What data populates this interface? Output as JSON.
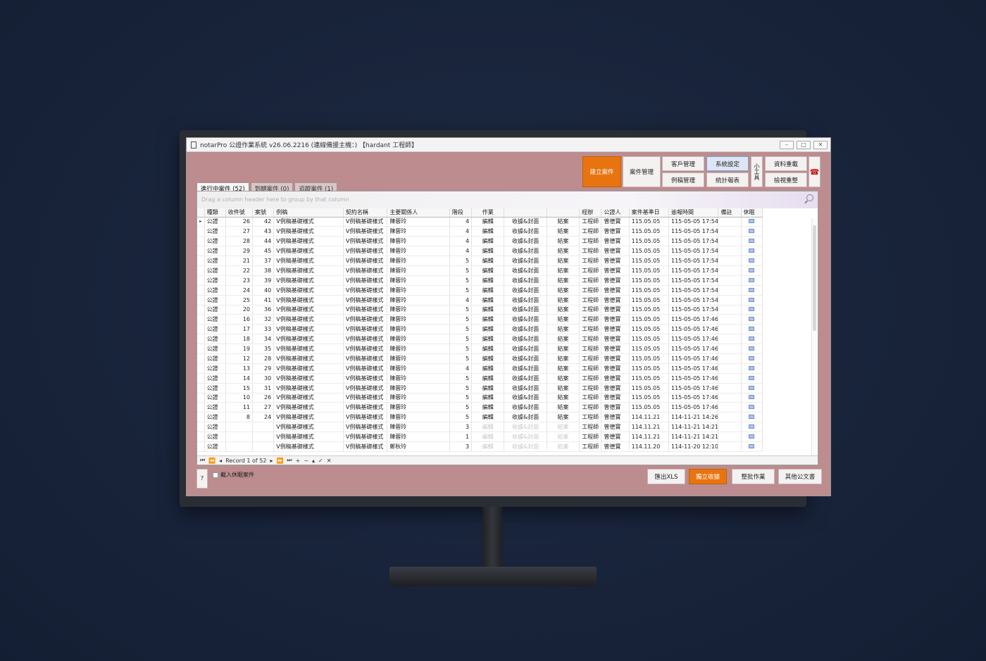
{
  "window": {
    "title": "notarPro 公證作業系統 v26.06.2216 (連線備援主機：) 【hardant 工程師】",
    "min_label": "–",
    "max_label": "□",
    "close_label": "✕"
  },
  "toolbar": {
    "create_case": "建立案件",
    "case_mgmt": "案件管理",
    "client_mgmt": "客戶管理",
    "system_settings": "系統設定",
    "template_mgmt": "例稿管理",
    "statistics": "統計報表",
    "tools": "小工具",
    "reload_data": "資料重載",
    "reset_view": "檢視重整",
    "phone_icon": "☎"
  },
  "tabs": [
    {
      "label": "進行中案件 (52)"
    },
    {
      "label": "到期案件 (0)"
    },
    {
      "label": "追蹤案件 (1)"
    }
  ],
  "grid": {
    "group_hint": "Drag a column header here to group by that column",
    "columns": [
      "種類",
      "收件號",
      "案號",
      "例稿",
      "契約名稱",
      "主要關係人",
      "階段",
      "作業",
      "",
      "",
      "經辦",
      "公證人",
      "案件基準日",
      "逾報時間",
      "備註",
      "休眠"
    ],
    "rows": [
      [
        "公證",
        "26",
        "42",
        "V例稿基礎樣式",
        "V例稿基礎樣式",
        "陳蓉玲",
        "4",
        "編輯",
        "收據&封面",
        "結案",
        "工程師",
        "曾德寶",
        "115.05.05",
        "115-05-05 17:54",
        ""
      ],
      [
        "公證",
        "27",
        "43",
        "V例稿基礎樣式",
        "V例稿基礎樣式",
        "陳蓉玲",
        "4",
        "編輯",
        "收據&封面",
        "結案",
        "工程師",
        "曾德寶",
        "115.05.05",
        "115-05-05 17:54",
        ""
      ],
      [
        "公證",
        "28",
        "44",
        "V例稿基礎樣式",
        "V例稿基礎樣式",
        "陳蓉玲",
        "4",
        "編輯",
        "收據&封面",
        "結案",
        "工程師",
        "曾德寶",
        "115.05.05",
        "115-05-05 17:54",
        ""
      ],
      [
        "公證",
        "29",
        "45",
        "V例稿基礎樣式",
        "V例稿基礎樣式",
        "陳蓉玲",
        "4",
        "編輯",
        "收據&封面",
        "結案",
        "工程師",
        "曾德寶",
        "115.05.05",
        "115-05-05 17:54",
        ""
      ],
      [
        "公證",
        "21",
        "37",
        "V例稿基礎樣式",
        "V例稿基礎樣式",
        "陳蓉玲",
        "5",
        "編輯",
        "收據&封面",
        "結案",
        "工程師",
        "曾德寶",
        "115.05.05",
        "115-05-05 17:54",
        ""
      ],
      [
        "公證",
        "22",
        "38",
        "V例稿基礎樣式",
        "V例稿基礎樣式",
        "陳蓉玲",
        "5",
        "編輯",
        "收據&封面",
        "結案",
        "工程師",
        "曾德寶",
        "115.05.05",
        "115-05-05 17:54",
        ""
      ],
      [
        "公證",
        "23",
        "39",
        "V例稿基礎樣式",
        "V例稿基礎樣式",
        "陳蓉玲",
        "5",
        "編輯",
        "收據&封面",
        "結案",
        "工程師",
        "曾德寶",
        "115.05.05",
        "115-05-05 17:54",
        ""
      ],
      [
        "公證",
        "24",
        "40",
        "V例稿基礎樣式",
        "V例稿基礎樣式",
        "陳蓉玲",
        "5",
        "編輯",
        "收據&封面",
        "結案",
        "工程師",
        "曾德寶",
        "115.05.05",
        "115-05-05 17:54",
        ""
      ],
      [
        "公證",
        "25",
        "41",
        "V例稿基礎樣式",
        "V例稿基礎樣式",
        "陳蓉玲",
        "4",
        "編輯",
        "收據&封面",
        "結案",
        "工程師",
        "曾德寶",
        "115.05.05",
        "115-05-05 17:54",
        ""
      ],
      [
        "公證",
        "20",
        "36",
        "V例稿基礎樣式",
        "V例稿基礎樣式",
        "陳蓉玲",
        "5",
        "編輯",
        "收據&封面",
        "結案",
        "工程師",
        "曾德寶",
        "115.05.05",
        "115-05-05 17:54",
        ""
      ],
      [
        "公證",
        "16",
        "32",
        "V例稿基礎樣式",
        "V例稿基礎樣式",
        "陳蓉玲",
        "5",
        "編輯",
        "收據&封面",
        "結案",
        "工程師",
        "曾德寶",
        "115.05.05",
        "115-05-05 17:46",
        ""
      ],
      [
        "公證",
        "17",
        "33",
        "V例稿基礎樣式",
        "V例稿基礎樣式",
        "陳蓉玲",
        "5",
        "編輯",
        "收據&封面",
        "結案",
        "工程師",
        "曾德寶",
        "115.05.05",
        "115-05-05 17:46",
        ""
      ],
      [
        "公證",
        "18",
        "34",
        "V例稿基礎樣式",
        "V例稿基礎樣式",
        "陳蓉玲",
        "5",
        "編輯",
        "收據&封面",
        "結案",
        "工程師",
        "曾德寶",
        "115.05.05",
        "115-05-05 17:46",
        ""
      ],
      [
        "公證",
        "19",
        "35",
        "V例稿基礎樣式",
        "V例稿基礎樣式",
        "陳蓉玲",
        "5",
        "編輯",
        "收據&封面",
        "結案",
        "工程師",
        "曾德寶",
        "115.05.05",
        "115-05-05 17:46",
        ""
      ],
      [
        "公證",
        "12",
        "28",
        "V例稿基礎樣式",
        "V例稿基礎樣式",
        "陳蓉玲",
        "5",
        "編輯",
        "收據&封面",
        "結案",
        "工程師",
        "曾德寶",
        "115.05.05",
        "115-05-05 17:46",
        ""
      ],
      [
        "公證",
        "13",
        "29",
        "V例稿基礎樣式",
        "V例稿基礎樣式",
        "陳蓉玲",
        "4",
        "編輯",
        "收據&封面",
        "結案",
        "工程師",
        "曾德寶",
        "115.05.05",
        "115-05-05 17:46",
        ""
      ],
      [
        "公證",
        "14",
        "30",
        "V例稿基礎樣式",
        "V例稿基礎樣式",
        "陳蓉玲",
        "5",
        "編輯",
        "收據&封面",
        "結案",
        "工程師",
        "曾德寶",
        "115.05.05",
        "115-05-05 17:46",
        ""
      ],
      [
        "公證",
        "15",
        "31",
        "V例稿基礎樣式",
        "V例稿基礎樣式",
        "陳蓉玲",
        "5",
        "編輯",
        "收據&封面",
        "結案",
        "工程師",
        "曾德寶",
        "115.05.05",
        "115-05-05 17:46",
        ""
      ],
      [
        "公證",
        "10",
        "26",
        "V例稿基礎樣式",
        "V例稿基礎樣式",
        "陳蓉玲",
        "5",
        "編輯",
        "收據&封面",
        "結案",
        "工程師",
        "曾德寶",
        "115.05.05",
        "115-05-05 17:46",
        ""
      ],
      [
        "公證",
        "11",
        "27",
        "V例稿基礎樣式",
        "V例稿基礎樣式",
        "陳蓉玲",
        "5",
        "編輯",
        "收據&封面",
        "結案",
        "工程師",
        "曾德寶",
        "115.05.05",
        "115-05-05 17:46",
        ""
      ],
      [
        "公證",
        "8",
        "24",
        "V例稿基礎樣式",
        "V例稿基礎樣式",
        "陳蓉玲",
        "5",
        "編輯",
        "收據&封面",
        "結案",
        "工程師",
        "曾德寶",
        "114.11.21",
        "114-11-21 14:26",
        ""
      ],
      [
        "公證",
        "",
        "",
        "V例稿基礎樣式",
        "V例稿基礎樣式",
        "陳蓉玲",
        "3",
        "編輯",
        "收據&封面",
        "結案",
        "工程師",
        "曾德寶",
        "114.11.21",
        "114-11-21 14:21",
        ""
      ],
      [
        "公證",
        "",
        "",
        "V例稿基礎樣式",
        "V例稿基礎樣式",
        "陳蓉玲",
        "1",
        "編輯",
        "收據&封面",
        "結案",
        "工程師",
        "曾德寶",
        "114.11.21",
        "114-11-21 14:21",
        ""
      ],
      [
        "公證",
        "",
        "",
        "V例稿基礎樣式",
        "V例稿基礎樣式",
        "鄭秋玲",
        "3",
        "編輯",
        "收據&封面",
        "結案",
        "工程師",
        "曾德寶",
        "114.11.20",
        "114-11-20 12:10",
        ""
      ]
    ],
    "dim_rows": [
      21,
      22,
      23
    ],
    "record_text": "Record 1 of 52"
  },
  "bottom": {
    "help": "?",
    "hibernate_label": "載入休眠案件",
    "export_xls": "匯出XLS",
    "create_receipt": "獨立收據",
    "batch_ops": "整批作業",
    "other_docs": "其他公文書"
  },
  "colors": {
    "background": "#bc8c8f",
    "accent": "#e8740f"
  }
}
